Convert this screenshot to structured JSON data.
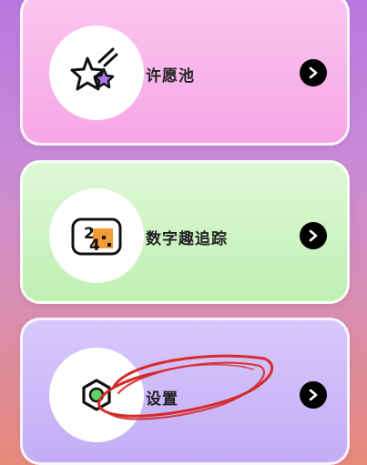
{
  "menu": {
    "items": [
      {
        "label": "许愿池",
        "icon": "wishing-star-icon"
      },
      {
        "label": "数字趣追踪",
        "icon": "number-tracker-icon"
      },
      {
        "label": "设置",
        "icon": "settings-hexagon-icon"
      }
    ],
    "arrow_icon": "chevron-right-icon"
  },
  "colors": {
    "wish_card": "#f6a6e6",
    "number_card": "#bff0b4",
    "settings_card": "#c4acf7",
    "annotation": "#d42a2a"
  }
}
